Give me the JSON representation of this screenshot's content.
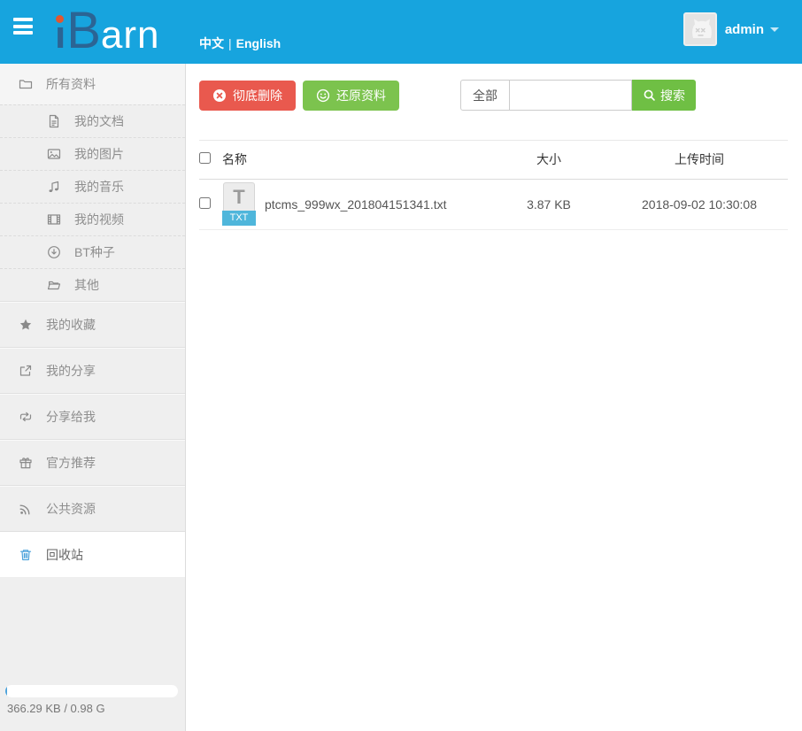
{
  "header": {
    "logo_i": "ı",
    "logo_b": "B",
    "logo_arn": "arn",
    "lang_zh": "中文",
    "lang_sep": "|",
    "lang_en": "English",
    "username": "admin"
  },
  "sidebar": {
    "items": [
      {
        "label": "所有资料"
      },
      {
        "label": "我的文档"
      },
      {
        "label": "我的图片"
      },
      {
        "label": "我的音乐"
      },
      {
        "label": "我的视频"
      },
      {
        "label": "BT种子"
      },
      {
        "label": "其他"
      },
      {
        "label": "我的收藏"
      },
      {
        "label": "我的分享"
      },
      {
        "label": "分享给我"
      },
      {
        "label": "官方推荐"
      },
      {
        "label": "公共资源"
      },
      {
        "label": "回收站"
      }
    ],
    "storage_text": "366.29 KB / 0.98 G"
  },
  "toolbar": {
    "delete_label": "彻底删除",
    "restore_label": "还原资料",
    "filter_label": "全部",
    "search_label": "搜索",
    "search_value": ""
  },
  "table": {
    "headers": {
      "name": "名称",
      "size": "大小",
      "time": "上传时间"
    },
    "rows": [
      {
        "name": "ptcms_999wx_201804151341.txt",
        "type_letter": "T",
        "type_ext": "TXT",
        "size": "3.87 KB",
        "time": "2018-09-02 10:30:08"
      }
    ]
  },
  "colors": {
    "header_blue": "#17a4de",
    "delete_red": "#e9594e",
    "restore_green": "#7cc34e",
    "txt_badge_blue": "#4fb6db",
    "active_icon_blue": "#4da3db"
  }
}
